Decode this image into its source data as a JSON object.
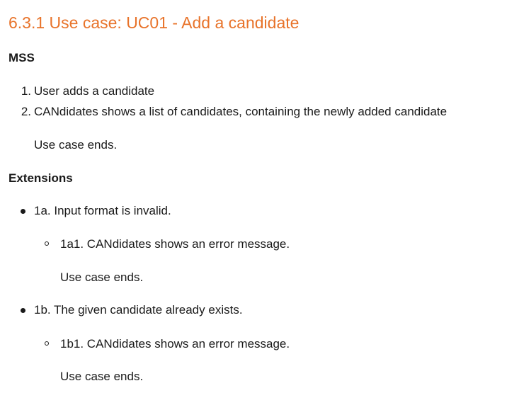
{
  "heading": {
    "title": "6.3.1 Use case: UC01 - Add a candidate",
    "color": "#e8732a"
  },
  "mss": {
    "label": "MSS",
    "steps": [
      {
        "number": "1.",
        "text": "User adds a candidate"
      },
      {
        "number": "2.",
        "text": "CANdidates shows a list of candidates, containing the newly added candidate"
      }
    ],
    "end_text": "Use case ends."
  },
  "extensions": {
    "label": "Extensions",
    "items": [
      {
        "text": "1a. Input format is invalid.",
        "sub": {
          "text": "1a1. CANdidates shows an error message.",
          "end_text": "Use case ends."
        }
      },
      {
        "text": "1b. The given candidate already exists.",
        "sub": {
          "text": "1b1. CANdidates shows an error message.",
          "end_text": "Use case ends."
        }
      }
    ]
  }
}
